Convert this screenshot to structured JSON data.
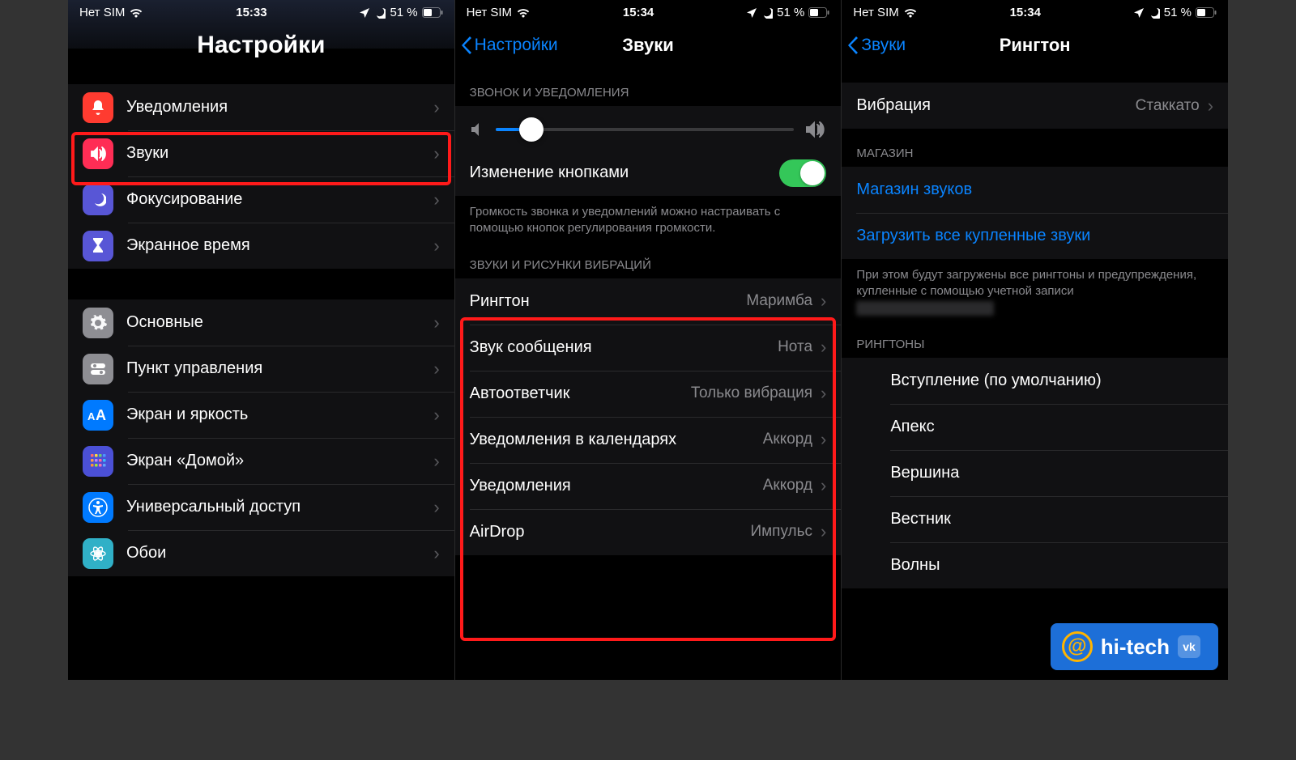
{
  "status": {
    "carrier": "Нет SIM",
    "battery": "51 %"
  },
  "phone1": {
    "time": "15:33",
    "title": "Настройки",
    "group1": [
      {
        "icon": "bell",
        "color": "#ff3b30",
        "label": "Уведомления"
      },
      {
        "icon": "speaker",
        "color": "#ff2d55",
        "label": "Звуки",
        "highlight": true
      },
      {
        "icon": "moon",
        "color": "#5856d6",
        "label": "Фокусирование"
      },
      {
        "icon": "hourglass",
        "color": "#5856d6",
        "label": "Экранное время"
      }
    ],
    "group2": [
      {
        "icon": "gear",
        "color": "#8e8e93",
        "label": "Основные"
      },
      {
        "icon": "switches",
        "color": "#8e8e93",
        "label": "Пункт управления"
      },
      {
        "icon": "aa",
        "color": "#007aff",
        "label": "Экран и яркость"
      },
      {
        "icon": "grid",
        "color": "#4b50d6",
        "label": "Экран «Домой»"
      },
      {
        "icon": "accessibility",
        "color": "#007aff",
        "label": "Универсальный доступ"
      },
      {
        "icon": "flower",
        "color": "#30b0c7",
        "label": "Обои"
      }
    ]
  },
  "phone2": {
    "time": "15:34",
    "back": "Настройки",
    "title": "Звуки",
    "section1_header": "ЗВОНОК И УВЕДОМЛЕНИЯ",
    "change_buttons": "Изменение кнопками",
    "section1_footer": "Громкость звонка и уведомлений можно настраивать с помощью кнопок регулирования громкости.",
    "section2_header": "ЗВУКИ И РИСУНКИ ВИБРАЦИЙ",
    "sounds": [
      {
        "label": "Рингтон",
        "value": "Маримба"
      },
      {
        "label": "Звук сообщения",
        "value": "Нота"
      },
      {
        "label": "Автоответчик",
        "value": "Только вибрация"
      },
      {
        "label": "Уведомления в календарях",
        "value": "Аккорд"
      },
      {
        "label": "Уведомления",
        "value": "Аккорд"
      },
      {
        "label": "AirDrop",
        "value": "Импульс"
      }
    ],
    "slider_pct": 12
  },
  "phone3": {
    "time": "15:34",
    "back": "Звуки",
    "title": "Рингтон",
    "vibration_label": "Вибрация",
    "vibration_value": "Стаккато",
    "store_header": "МАГАЗИН",
    "store_link": "Магазин звуков",
    "download_link": "Загрузить все купленные звуки",
    "store_footer": "При этом будут загружены все рингтоны и предупреждения, купленные с помощью учетной записи",
    "ringtones_header": "РИНГТОНЫ",
    "ringtones": [
      "Вступление (по умолчанию)",
      "Апекс",
      "Вершина",
      "Вестник",
      "Волны"
    ]
  },
  "badge": "hi-tech"
}
